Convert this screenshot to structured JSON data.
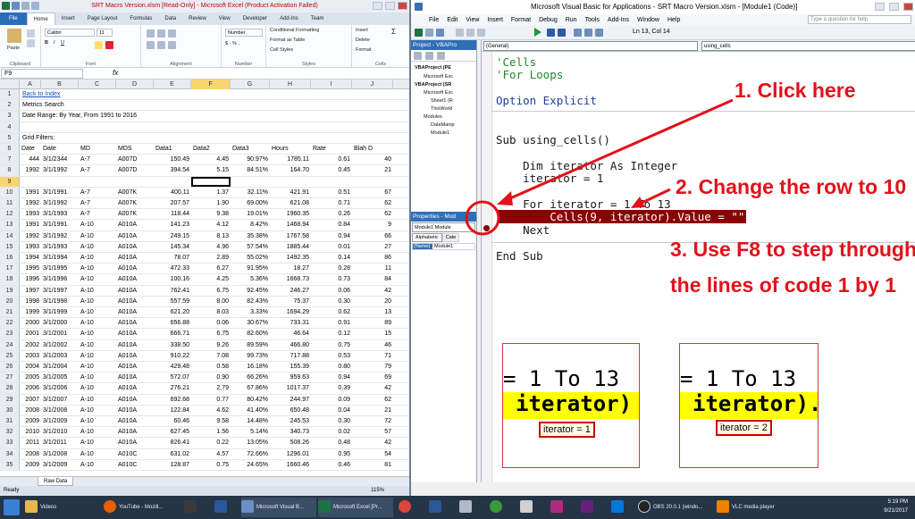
{
  "excel": {
    "title": "SRT Macro Version.xlsm  [Read-Only]  -  Microsoft Excel (Product Activation Failed)",
    "tabs": [
      "File",
      "Home",
      "Insert",
      "Page Layout",
      "Formulas",
      "Data",
      "Review",
      "View",
      "Developer",
      "Add-Ins",
      "Team"
    ],
    "ribbon": {
      "paste": "Paste",
      "clipboard": "Clipboard",
      "font_name": "Calibri",
      "font_size": "11",
      "font": "Font",
      "alignment": "Alignment",
      "number_format": "Number",
      "number": "Number",
      "cond_format": "Conditional Formatting",
      "format_table": "Format as Table",
      "cell_styles": "Cell Styles",
      "styles": "Styles",
      "insert": "Insert",
      "delete": "Delete",
      "format": "Format",
      "cells": "Cells",
      "sigma": "Σ"
    },
    "name_box": "F9",
    "fx": "fx",
    "columns": [
      "A",
      "B",
      "C",
      "D",
      "E",
      "F",
      "G",
      "H",
      "I",
      "J"
    ],
    "selected_cell_col": "F",
    "selected_row": "9",
    "rows": [
      {
        "n": "1",
        "a": "Back to Index",
        "link": true
      },
      {
        "n": "2",
        "a": "Metrics Search"
      },
      {
        "n": "3",
        "a": "Date Range: By Year, From 1991 to 2016"
      },
      {
        "n": "4"
      },
      {
        "n": "5",
        "a": "Grid Filters:"
      },
      {
        "n": "6",
        "cells": [
          "Date",
          "Date",
          "MD",
          "MDS",
          "Data1",
          "Data2",
          "Data3",
          "Hours",
          "Rate",
          "Blah D"
        ]
      },
      {
        "n": "7",
        "cells": [
          "444",
          "3/1/2344",
          "A-7",
          "A007D",
          "150.49",
          "4.45",
          "90.97%",
          "1785.11",
          "0.61",
          "40"
        ]
      },
      {
        "n": "8",
        "cells": [
          "1992",
          "3/1/1992",
          "A-7",
          "A007D",
          "394.54",
          "5.15",
          "84.51%",
          "164.70",
          "0.45",
          "21"
        ]
      },
      {
        "n": "9"
      },
      {
        "n": "10",
        "cells": [
          "1991",
          "3/1/1991",
          "A-7",
          "A007K",
          "400.11",
          "1.37",
          "32.11%",
          "421.91",
          "0.51",
          "67"
        ]
      },
      {
        "n": "11",
        "cells": [
          "1992",
          "3/1/1992",
          "A-7",
          "A007K",
          "207.57",
          "1.90",
          "69.00%",
          "621.08",
          "0.71",
          "62"
        ]
      },
      {
        "n": "12",
        "cells": [
          "1993",
          "3/1/1993",
          "A-7",
          "A007K",
          "118.44",
          "9.38",
          "19.01%",
          "1960.35",
          "0.26",
          "62"
        ]
      },
      {
        "n": "13",
        "cells": [
          "1991",
          "3/1/1991",
          "A-10",
          "A010A",
          "141.23",
          "4.12",
          "8.42%",
          "1468.94",
          "0.84",
          "9"
        ]
      },
      {
        "n": "14",
        "cells": [
          "1992",
          "3/1/1992",
          "A-10",
          "A010A",
          "249.15",
          "8.13",
          "35.38%",
          "1767.58",
          "0.94",
          "66"
        ]
      },
      {
        "n": "15",
        "cells": [
          "1993",
          "3/1/1993",
          "A-10",
          "A010A",
          "145.34",
          "4.96",
          "57.54%",
          "1885.44",
          "0.01",
          "27"
        ]
      },
      {
        "n": "16",
        "cells": [
          "1994",
          "3/1/1994",
          "A-10",
          "A010A",
          "78.07",
          "2.89",
          "55.02%",
          "1492.35",
          "0.14",
          "86"
        ]
      },
      {
        "n": "17",
        "cells": [
          "1995",
          "3/1/1995",
          "A-10",
          "A010A",
          "472.33",
          "6.27",
          "91.95%",
          "18.27",
          "0.28",
          "11"
        ]
      },
      {
        "n": "18",
        "cells": [
          "1996",
          "3/1/1996",
          "A-10",
          "A010A",
          "100.16",
          "4.25",
          "5.36%",
          "1668.73",
          "0.73",
          "84"
        ]
      },
      {
        "n": "19",
        "cells": [
          "1997",
          "3/1/1997",
          "A-10",
          "A010A",
          "762.41",
          "6.75",
          "92.45%",
          "246.27",
          "0.06",
          "42"
        ]
      },
      {
        "n": "20",
        "cells": [
          "1998",
          "3/1/1998",
          "A-10",
          "A010A",
          "557.59",
          "8.00",
          "82.43%",
          "75.37",
          "0.30",
          "20"
        ]
      },
      {
        "n": "21",
        "cells": [
          "1999",
          "3/1/1999",
          "A-10",
          "A010A",
          "621.20",
          "8.03",
          "3.33%",
          "1694.29",
          "0.62",
          "13"
        ]
      },
      {
        "n": "22",
        "cells": [
          "2000",
          "3/1/2000",
          "A-10",
          "A010A",
          "656.88",
          "0.06",
          "30.67%",
          "733.31",
          "0.91",
          "89"
        ]
      },
      {
        "n": "23",
        "cells": [
          "2001",
          "3/1/2001",
          "A-10",
          "A010A",
          "666.71",
          "6.75",
          "82.60%",
          "46.64",
          "0.12",
          "15"
        ]
      },
      {
        "n": "24",
        "cells": [
          "2002",
          "3/1/2002",
          "A-10",
          "A010A",
          "338.50",
          "9.26",
          "89.59%",
          "466.80",
          "0.75",
          "46"
        ]
      },
      {
        "n": "25",
        "cells": [
          "2003",
          "3/1/2003",
          "A-10",
          "A010A",
          "910.22",
          "7.08",
          "99.73%",
          "717.88",
          "0.53",
          "71"
        ]
      },
      {
        "n": "26",
        "cells": [
          "2004",
          "3/1/2004",
          "A-10",
          "A010A",
          "429.48",
          "0.58",
          "16.18%",
          "155.39",
          "0.80",
          "79"
        ]
      },
      {
        "n": "27",
        "cells": [
          "2005",
          "3/1/2005",
          "A-10",
          "A010A",
          "572.07",
          "0.90",
          "66.26%",
          "959.63",
          "0.94",
          "69"
        ]
      },
      {
        "n": "28",
        "cells": [
          "2006",
          "3/1/2006",
          "A-10",
          "A010A",
          "276.21",
          "2.79",
          "67.86%",
          "1017.37",
          "0.39",
          "42"
        ]
      },
      {
        "n": "29",
        "cells": [
          "2007",
          "3/1/2007",
          "A-10",
          "A010A",
          "692.68",
          "0.77",
          "80.42%",
          "244.97",
          "0.09",
          "62"
        ]
      },
      {
        "n": "30",
        "cells": [
          "2008",
          "3/1/2008",
          "A-10",
          "A010A",
          "122.84",
          "4.62",
          "41.40%",
          "650.48",
          "0.04",
          "21"
        ]
      },
      {
        "n": "31",
        "cells": [
          "2009",
          "3/1/2009",
          "A-10",
          "A010A",
          "60.46",
          "9.58",
          "14.48%",
          "245.53",
          "0.30",
          "72"
        ]
      },
      {
        "n": "32",
        "cells": [
          "2010",
          "3/1/2010",
          "A-10",
          "A010A",
          "627.45",
          "1.56",
          "5.14%",
          "340.73",
          "0.02",
          "57"
        ]
      },
      {
        "n": "33",
        "cells": [
          "2011",
          "3/1/2011",
          "A-10",
          "A010A",
          "826.41",
          "0.22",
          "13.05%",
          "508.26",
          "0.48",
          "42"
        ]
      },
      {
        "n": "34",
        "cells": [
          "2008",
          "3/1/2008",
          "A-10",
          "A010C",
          "631.02",
          "4.57",
          "72.66%",
          "1296.01",
          "0.95",
          "54"
        ]
      },
      {
        "n": "35",
        "cells": [
          "2009",
          "3/1/2009",
          "A-10",
          "A010C",
          "128.87",
          "0.75",
          "24.65%",
          "1660.46",
          "0.46",
          "81"
        ]
      }
    ],
    "sheet_tab": "Raw Data",
    "status": "Ready",
    "zoom": "115%"
  },
  "vbe": {
    "title": "Microsoft Visual Basic for Applications - SRT Macro Version.xlsm - [Module1 (Code)]",
    "menu": [
      "File",
      "Edit",
      "View",
      "Insert",
      "Format",
      "Debug",
      "Run",
      "Tools",
      "Add-Ins",
      "Window",
      "Help"
    ],
    "position": "Ln 13, Col 14",
    "help_placeholder": "Type a question for help",
    "project_title": "Project - VBAPro",
    "tree": [
      "VBAProject (PE",
      "Microsoft Exc",
      "VBAProject (SR",
      "Microsoft Exc",
      "Sheet1 (R",
      "ThisWorkl",
      "Modules",
      "DataManip",
      "Module1"
    ],
    "props_title": "Properties - Mod",
    "props_object": "Module1 Module",
    "props_tabs": [
      "Alphabetic",
      "Cate"
    ],
    "props_row": [
      "(Name)",
      "Module1"
    ],
    "combo_general": "(General)",
    "combo_proc": "using_cells",
    "code": {
      "c1": "'Cells",
      "c2": "'For Loops",
      "c3": "Option Explicit",
      "c4": "Sub using_cells()",
      "c5": "    Dim iterator As Integer",
      "c6": "    iterator = 1",
      "c7": "    For iterator = 1 To 13",
      "c8": "        Cells(9, iterator).Value = \"\"",
      "c9": "    Next",
      "c10": "End Sub"
    },
    "annotations": {
      "a1": "1. Click here",
      "a2": "2. Change the row to 10",
      "a3": "3. Use F8 to step through",
      "a4": "the lines of code 1 by 1"
    },
    "zoom1": {
      "line": "= 1 To 13",
      "code": "iterator)",
      "tip": "iterator = 1"
    },
    "zoom2": {
      "line": "= 1 To 13",
      "code": "iterator).",
      "tip": "iterator = 2"
    }
  },
  "taskbar": {
    "items": [
      "Videos",
      "YouTube - Mozill...",
      "",
      "",
      "Microsoft Visual B...",
      "Microsoft Excel [Pr...",
      "",
      "",
      "",
      "",
      "",
      "",
      "OBS 20.0.1 (windo...",
      "VLC media player"
    ],
    "time": "5:19 PM",
    "date": "9/21/2017"
  },
  "colors": {
    "annotation": "#e2111a",
    "breakpoint": "#8b0000",
    "comment": "#1f8a2a",
    "selected_header": "#f8d66f"
  }
}
